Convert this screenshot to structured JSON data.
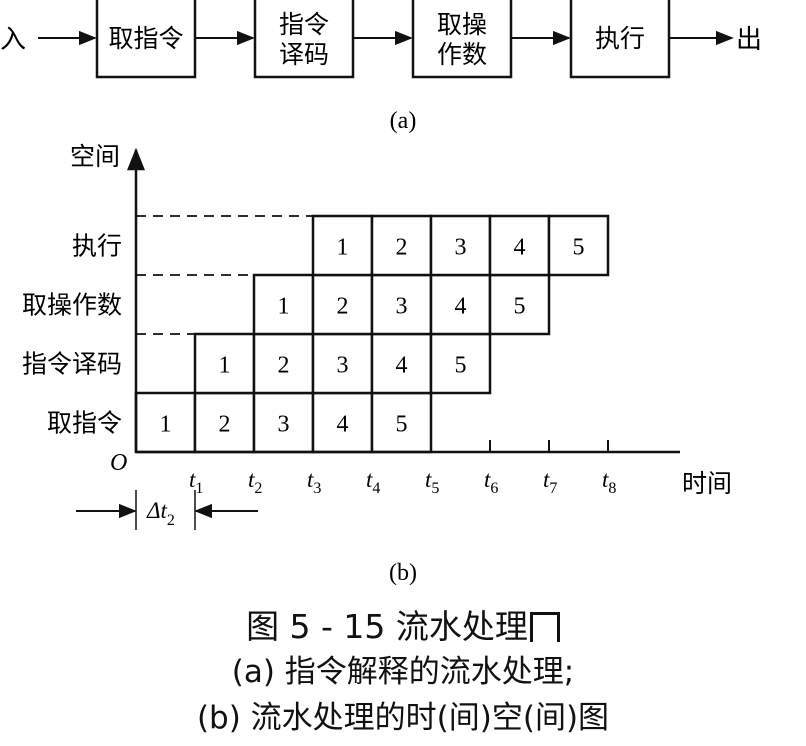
{
  "pipeline": {
    "input_label": "入",
    "output_label": "出",
    "stages": [
      "取指令",
      "指令\n译码",
      "取操\n作数",
      "执行"
    ],
    "sublabel": "(a)"
  },
  "spacetime": {
    "y_axis_label": "空间",
    "x_axis_label": "时间",
    "origin_label": "O",
    "rows": [
      "取指令",
      "指令译码",
      "取操作数",
      "执行"
    ],
    "ticks": [
      "1",
      "2",
      "3",
      "4",
      "5",
      "6",
      "7",
      "8"
    ],
    "tick_prefix": "t",
    "delta_label": "Δt",
    "delta_sub": "2",
    "instructions": [
      "1",
      "2",
      "3",
      "4",
      "5"
    ],
    "sublabel": "(b)"
  },
  "caption": {
    "title": "图 5 - 15  流水处理",
    "line1": "(a) 指令解释的流水处理;",
    "line2": "(b) 流水处理的时(间)空(间)图"
  }
}
